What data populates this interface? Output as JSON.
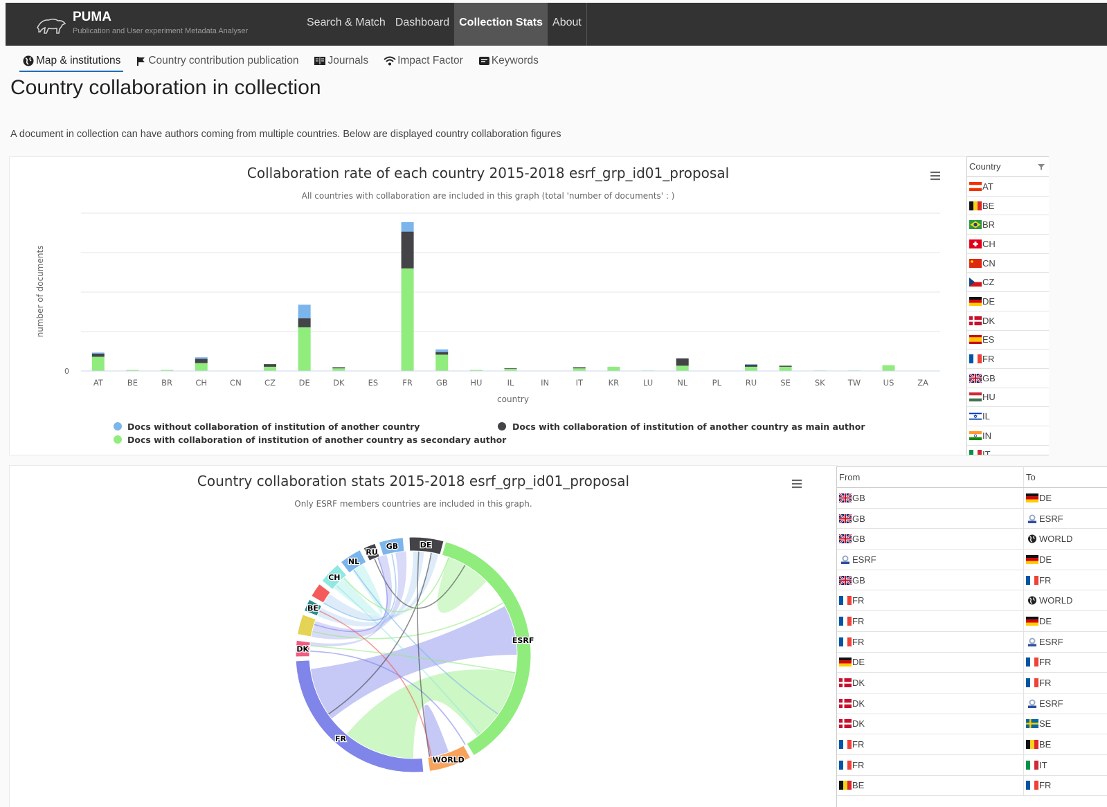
{
  "app": {
    "name": "PUMA",
    "subtitle": "Publication and User experiment Metadata Analyser"
  },
  "nav": [
    {
      "label": "Search & Match",
      "active": false
    },
    {
      "label": "Dashboard",
      "active": false
    },
    {
      "label": "Collection Stats",
      "active": true
    },
    {
      "label": "About",
      "active": false
    }
  ],
  "subtabs": [
    {
      "label": "Map & institutions",
      "icon": "globe-icon",
      "active": true
    },
    {
      "label": "Country contribution publication",
      "icon": "flag-icon",
      "active": false
    },
    {
      "label": "Journals",
      "icon": "book-icon",
      "active": false
    },
    {
      "label": "Impact Factor",
      "icon": "wifi-icon",
      "active": false
    },
    {
      "label": "Keywords",
      "icon": "tag-icon",
      "active": false
    }
  ],
  "page": {
    "title": "Country collaboration in collection",
    "description": "A document in collection can have authors coming from multiple countries. Below are displayed country collaboration figures"
  },
  "chart_data": [
    {
      "type": "bar",
      "stacked": true,
      "title": "Collaboration rate of each country 2015-2018 esrf_grp_id01_proposal",
      "subtitle": "All countries with collaboration are included in this graph (total 'number of documents' :      )",
      "xlabel": "country",
      "ylabel": "number of documents",
      "yticks": [
        "0"
      ],
      "ylim": [
        0,
        30
      ],
      "grid": true,
      "legend_position": "bottom",
      "categories": [
        "AT",
        "BE",
        "BR",
        "CH",
        "CN",
        "CZ",
        "DE",
        "DK",
        "ES",
        "FR",
        "GB",
        "HU",
        "IL",
        "IN",
        "IT",
        "KR",
        "LU",
        "NL",
        "PL",
        "RU",
        "SE",
        "SK",
        "TW",
        "US",
        "ZA"
      ],
      "series": [
        {
          "name": "Docs with collaboration of institution of another country as secondary author",
          "color": "#90ed7d",
          "values": [
            2.7,
            0.2,
            0.2,
            1.5,
            0,
            0.8,
            8.3,
            0.5,
            0,
            19.5,
            3.1,
            0.2,
            0.4,
            0,
            0.5,
            0.8,
            0.1,
            1.0,
            0,
            0.8,
            0.8,
            0.1,
            0.1,
            1.1,
            0
          ]
        },
        {
          "name": "Docs with collaboration of institution of another country as main author",
          "color": "#434348",
          "values": [
            0.6,
            0,
            0,
            0.8,
            0,
            0.5,
            1.7,
            0.2,
            0,
            7.0,
            0.5,
            0,
            0.1,
            0,
            0.2,
            0,
            0,
            1.4,
            0,
            0.4,
            0.2,
            0,
            0,
            0,
            0
          ]
        },
        {
          "name": "Docs without collaboration of institution of another country",
          "color": "#7cb5ec",
          "values": [
            0.2,
            0,
            0,
            0.3,
            0,
            0,
            2.6,
            0,
            0,
            1.8,
            0.5,
            0,
            0,
            0,
            0,
            0,
            0,
            0,
            0,
            0.1,
            0,
            0,
            0,
            0,
            0
          ]
        }
      ]
    },
    {
      "type": "chord",
      "title": "Country collaboration stats 2015-2018 esrf_grp_id01_proposal",
      "subtitle": "Only ESRF members countries are included in this graph.",
      "nodes": [
        {
          "label": "ESRF",
          "color": "#90ed7d"
        },
        {
          "label": "WORLD",
          "color": "#f7a35c"
        },
        {
          "label": "FR",
          "color": "#8085e9"
        },
        {
          "label": "DK",
          "color": "#f15c80"
        },
        {
          "label": "",
          "color": "#e4d354"
        },
        {
          "label": "BE",
          "color": "#2b908f"
        },
        {
          "label": "",
          "color": "#f45b5b"
        },
        {
          "label": "CH",
          "color": "#91e8e1"
        },
        {
          "label": "NL",
          "color": "#7cb5ec"
        },
        {
          "label": "RU",
          "color": "#434348"
        },
        {
          "label": "GB",
          "color": "#7cb5ec"
        },
        {
          "label": "DE",
          "color": "#434348"
        }
      ]
    }
  ],
  "country_table": {
    "header": "Country",
    "rows": [
      "AT",
      "BE",
      "BR",
      "CH",
      "CN",
      "CZ",
      "DE",
      "DK",
      "ES",
      "FR",
      "GB",
      "HU",
      "IL",
      "IN",
      "IT"
    ]
  },
  "links_table": {
    "headers": {
      "from": "From",
      "to": "To"
    },
    "rows": [
      {
        "from": "GB",
        "to": "DE"
      },
      {
        "from": "GB",
        "to": "ESRF"
      },
      {
        "from": "GB",
        "to": "WORLD"
      },
      {
        "from": "ESRF",
        "to": "DE"
      },
      {
        "from": "GB",
        "to": "FR"
      },
      {
        "from": "FR",
        "to": "WORLD"
      },
      {
        "from": "FR",
        "to": "DE"
      },
      {
        "from": "FR",
        "to": "ESRF"
      },
      {
        "from": "DE",
        "to": "FR"
      },
      {
        "from": "DK",
        "to": "FR"
      },
      {
        "from": "DK",
        "to": "ESRF"
      },
      {
        "from": "DK",
        "to": "SE"
      },
      {
        "from": "FR",
        "to": "BE"
      },
      {
        "from": "FR",
        "to": "IT"
      },
      {
        "from": "BE",
        "to": "FR"
      }
    ]
  }
}
